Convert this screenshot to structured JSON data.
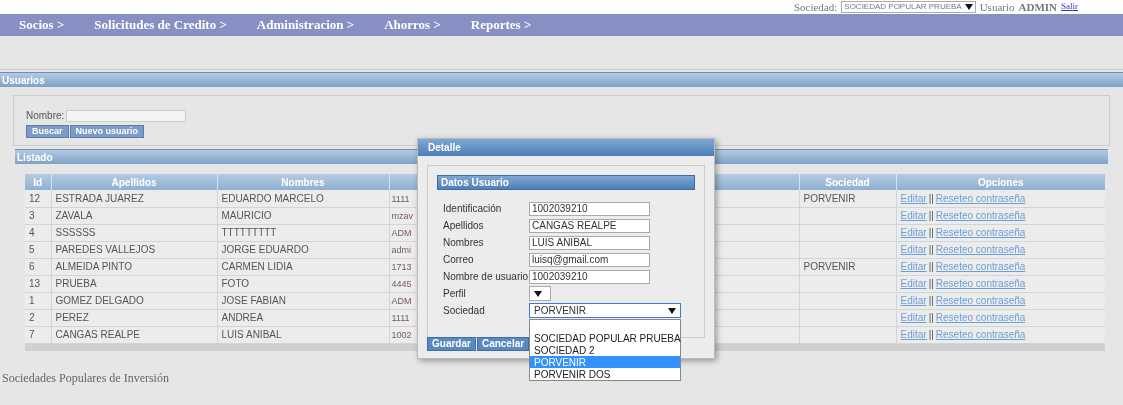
{
  "top_bar": {
    "sociedad_label": "Sociedad:",
    "sociedad_select": "SOCIEDAD POPULAR PRUEBA",
    "usuario_label": "Usuario",
    "usuario_name": "ADMIN",
    "logout_link": "Salir"
  },
  "nav": [
    "Socios >",
    "Solicitudes de Credito >",
    "Administracion >",
    "Ahorros >",
    "Reportes >"
  ],
  "usuarios_panel": {
    "title": "Usuarios",
    "search_label": "Nombre:",
    "buttons": [
      "Buscar",
      "Nuevo usuario"
    ]
  },
  "listado": {
    "title": "Listado",
    "columns": [
      "Id",
      "Apellidos",
      "Nombres",
      "Sociedad",
      "Opciones"
    ],
    "rows": [
      {
        "id": "12",
        "apellidos": "ESTRADA JUAREZ",
        "nombres": "EDUARDO MARCELO",
        "column_4": "1111",
        "sociedad": "PORVENIR",
        "edit_link": "Editar",
        "separator": "||",
        "reset_link": "Reseteo contraseña"
      },
      {
        "id": "3",
        "apellidos": "ZAVALA",
        "nombres": "MAURICIO",
        "column_4": "mzav",
        "edit_link": "Editar",
        "separator": "||",
        "reset_link": "Reseteo contraseña"
      },
      {
        "id": "4",
        "apellidos": "SSSSSS",
        "nombres": "TTTTTTTTT",
        "column_4": "ADM",
        "edit_link": "Editar",
        "separator": "||",
        "reset_link": "Reseteo contraseña"
      },
      {
        "id": "5",
        "apellidos": "PAREDES VALLEJOS",
        "nombres": "JORGE EDUARDO",
        "column_4": "admi",
        "edit_link": "Editar",
        "separator": "||",
        "reset_link": "Reseteo contraseña"
      },
      {
        "id": "6",
        "apellidos": "ALMEIDA PINTO",
        "nombres": "CARMEN LIDIA",
        "column_4": "1713",
        "sociedad": "PORVENIR",
        "edit_link": "Editar",
        "separator": "||",
        "reset_link": "Reseteo contraseña"
      },
      {
        "id": "13",
        "apellidos": "PRUEBA",
        "nombres": "FOTO",
        "column_4": "4445",
        "edit_link": "Editar",
        "separator": "||",
        "reset_link": "Reseteo contraseña"
      },
      {
        "id": "1",
        "apellidos": "GOMEZ DELGADO",
        "nombres": "JOSE FABIAN",
        "column_4": "ADM",
        "edit_link": "Editar",
        "separator": "||",
        "reset_link": "Reseteo contraseña"
      },
      {
        "id": "2",
        "apellidos": "PEREZ",
        "nombres": "ANDREA",
        "column_4": "1111",
        "edit_link": "Editar",
        "separator": "||",
        "reset_link": "Reseteo contraseña"
      },
      {
        "id": "7",
        "apellidos": "CANGAS REALPE",
        "nombres": "LUIS ANIBAL",
        "column_4": "1002",
        "edit_link": "Editar",
        "separator": "||",
        "reset_link": "Reseteo contraseña"
      }
    ]
  },
  "dialog": {
    "title": "Detalle",
    "section_title": "Datos Usuario",
    "fields": [
      {
        "kind": "text",
        "label": "Identificación",
        "value": "1002039210"
      },
      {
        "kind": "text",
        "label": "Apellidos",
        "value": "CANGAS REALPE"
      },
      {
        "kind": "text",
        "label": "Nombres",
        "value": "LUIS ANIBAL"
      },
      {
        "kind": "text",
        "label": "Correo",
        "value": "luisq@gmail.com"
      },
      {
        "kind": "text",
        "label": "Nombre de usuario",
        "value": "1002039210"
      },
      {
        "kind": "select",
        "label": "Perfil"
      },
      {
        "kind": "select",
        "label": "Sociedad",
        "value": "PORVENIR",
        "expanded": true,
        "options": [
          {
            "label": "SOCIEDAD POPULAR PRUEBA",
            "selected": false
          },
          {
            "label": "SOCIEDAD 2",
            "selected": false
          },
          {
            "label": "PORVENIR",
            "selected": true
          },
          {
            "label": "PORVENIR DOS",
            "selected": false
          }
        ]
      }
    ],
    "buttons": [
      "Guardar",
      "Cancelar"
    ]
  },
  "footer": "Sociedades Populares de Inversión"
}
